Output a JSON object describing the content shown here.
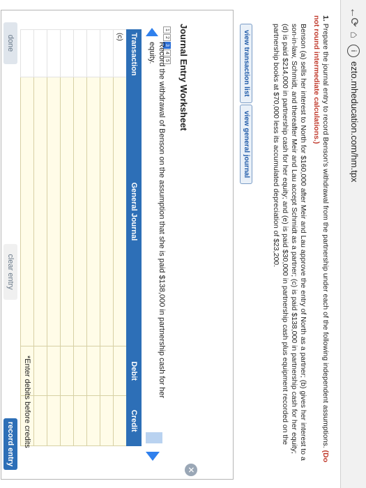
{
  "browser": {
    "back_icon": "←",
    "reload_icon": "⟳",
    "home_icon": "⌂",
    "info_icon": "i",
    "url": "ezto.mheducation.com/hm.tpx"
  },
  "question": {
    "number": "1.",
    "prompt": "Prepare the journal entry to record Benson's withdrawal from the partnership under each of the following independent assumptions.",
    "note": "(Do not round intermediate calculations.)",
    "scenario": "Benson (a) sells her interest to North for $160,000 after Meir and Lau approve the entry of North as a partner; (b) gives her interest to a son-in-law, Schmidt, and thereafter Meir and Lau accept Schmidt as a partner; (c) is paid $138,000 in partnership cash for her equity; (d) is paid $214,000 in partnership cash for her equity; and (e) is paid $30,000 in partnership cash plus equipment recorded on the partnership books at $70,000 less its accumulated depreciation of $23,200."
  },
  "tabs": {
    "view_transaction_list": "view transaction list",
    "view_general_journal": "view general journal"
  },
  "worksheet": {
    "title": "Journal Entry Worksheet",
    "close_icon": "✕",
    "steps": [
      "1",
      "2",
      "3",
      "4",
      "5"
    ],
    "active_step": 3,
    "instruction": "Record the withdrawal of Benson on the assumption that she is paid $138,000 in partnership cash for her equity.",
    "columns": {
      "transaction": "Transaction",
      "general_journal": "General Journal",
      "debit": "Debit",
      "credit": "Credit"
    },
    "rows": [
      {
        "transaction": "(c)"
      },
      {
        "transaction": ""
      },
      {
        "transaction": ""
      },
      {
        "transaction": ""
      },
      {
        "transaction": ""
      },
      {
        "transaction": ""
      },
      {
        "transaction": ""
      },
      {
        "transaction": ""
      }
    ],
    "footnote": "*Enter debits before credits"
  },
  "buttons": {
    "done": "done",
    "clear_entry": "clear entry",
    "record_entry": "record entry"
  }
}
